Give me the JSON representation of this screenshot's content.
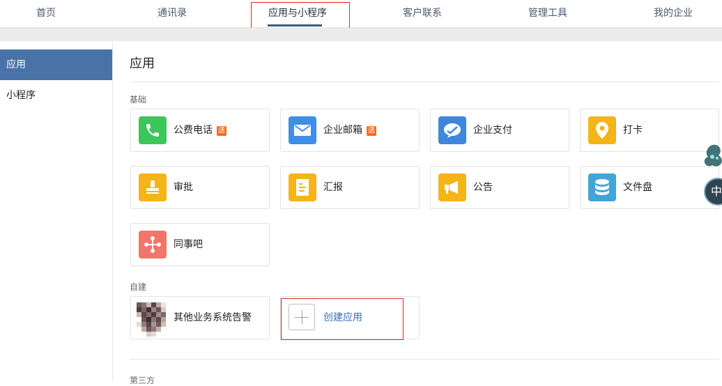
{
  "topnav": {
    "tabs": [
      {
        "label": "首页"
      },
      {
        "label": "通讯录"
      },
      {
        "label": "应用与小程序"
      },
      {
        "label": "客户联系"
      },
      {
        "label": "管理工具"
      },
      {
        "label": "我的企业"
      }
    ]
  },
  "sidebar": {
    "items": [
      {
        "label": "应用"
      },
      {
        "label": "小程序"
      }
    ]
  },
  "main": {
    "title": "应用",
    "sections": {
      "basic": "基础",
      "custom": "自建",
      "third": "第三方"
    },
    "apps": [
      {
        "name": "公费电话",
        "badge": "送",
        "icon": "phone-icon",
        "color": "#3dc65a"
      },
      {
        "name": "企业邮箱",
        "badge": "送",
        "icon": "mail-icon",
        "color": "#3f8ee8"
      },
      {
        "name": "企业支付",
        "badge": "",
        "icon": "payment-icon",
        "color": "#3f86de"
      },
      {
        "name": "打卡",
        "badge": "",
        "icon": "location-pin-icon",
        "color": "#f5b417"
      },
      {
        "name": "审批",
        "badge": "",
        "icon": "stamp-icon",
        "color": "#f5b417"
      },
      {
        "name": "汇报",
        "badge": "",
        "icon": "report-icon",
        "color": "#f5b417"
      },
      {
        "name": "公告",
        "badge": "",
        "icon": "megaphone-icon",
        "color": "#f5b417"
      },
      {
        "name": "文件盘",
        "badge": "",
        "icon": "database-icon",
        "color": "#42a5d8"
      },
      {
        "name": "同事吧",
        "badge": "",
        "icon": "network-icon",
        "color": "#f3746a"
      }
    ],
    "custom_apps": [
      {
        "name": "其他业务系统告警",
        "icon": "pixelated-logo-icon"
      }
    ],
    "create_label": "创建应用"
  },
  "floating": {
    "label": "中"
  }
}
